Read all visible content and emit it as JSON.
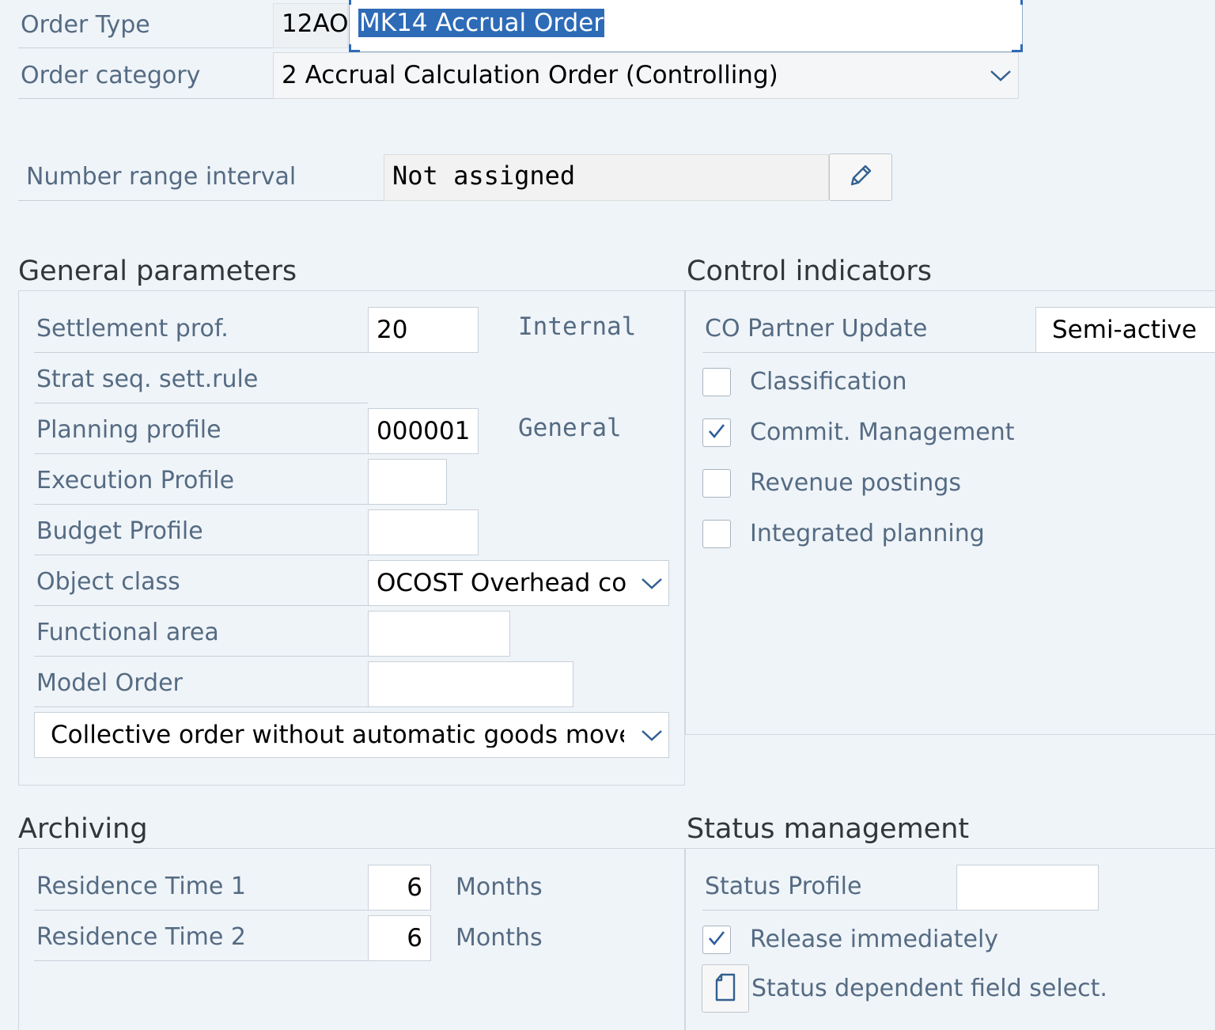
{
  "header": {
    "order_type_label": "Order Type",
    "order_type_code": "12AO",
    "order_type_desc": "MK14 Accrual Order",
    "order_category_label": "Order category",
    "order_category_value": "2 Accrual Calculation Order (Controlling)",
    "number_range_label": "Number range interval",
    "number_range_value": "Not assigned"
  },
  "general": {
    "title": "General parameters",
    "settlement_label": "Settlement prof.",
    "settlement_value": "20",
    "settlement_desc": "Internal",
    "strat_seq_label": "Strat seq. sett.rule",
    "planning_label": "Planning profile",
    "planning_value": "000001",
    "planning_desc": "General",
    "execution_label": "Execution Profile",
    "execution_value": "",
    "budget_label": "Budget Profile",
    "budget_value": "",
    "object_class_label": "Object class",
    "object_class_value": "OCOST Overhead co",
    "functional_area_label": "Functional area",
    "functional_area_value": "",
    "model_order_label": "Model Order",
    "model_order_value": "",
    "collective_value": "Collective order without automatic goods movem"
  },
  "control": {
    "title": "Control indicators",
    "co_partner_label": "CO Partner Update",
    "co_partner_value": "Semi-active",
    "checkboxes": [
      {
        "label": "Classification",
        "checked": false
      },
      {
        "label": "Commit. Management",
        "checked": true
      },
      {
        "label": "Revenue postings",
        "checked": false
      },
      {
        "label": "Integrated planning",
        "checked": false
      }
    ]
  },
  "archiving": {
    "title": "Archiving",
    "res1_label": "Residence Time 1",
    "res1_value": "6",
    "res1_unit": "Months",
    "res2_label": "Residence Time 2",
    "res2_value": "6",
    "res2_unit": "Months"
  },
  "status": {
    "title": "Status management",
    "profile_label": "Status Profile",
    "profile_value": "",
    "release_label": "Release immediately",
    "release_checked": true,
    "field_select_label": "Status dependent field select."
  },
  "icons": {
    "edit": "pencil-icon",
    "dropdown": "chevron-down-icon",
    "check": "check-icon",
    "document": "document-icon"
  },
  "colors": {
    "background": "#eff4f9",
    "label": "#556b82",
    "selection": "#2e6bb7",
    "focus_border": "#2e6bb7"
  }
}
